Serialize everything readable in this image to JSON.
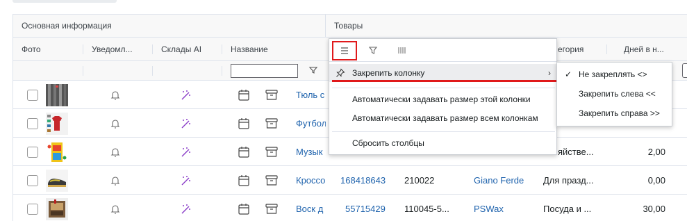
{
  "group_headers": {
    "main": "Основная информация",
    "products": "Товары"
  },
  "columns": {
    "photo": "Фото",
    "notifications": "Уведомл...",
    "warehouses_ai": "Склады AI",
    "name": "Название",
    "category": "егория",
    "days": "Дней в н..."
  },
  "rows": [
    {
      "name": "Тюль с",
      "id": "",
      "code": "",
      "brand": "",
      "category": "",
      "days": ""
    },
    {
      "name": "Футбол",
      "id": "",
      "code": "",
      "brand": "",
      "category": "",
      "days": ""
    },
    {
      "name": "Музык",
      "id": "",
      "code": "",
      "brand": "",
      "category": "яйстве...",
      "days": "2,00"
    },
    {
      "name": "Кроссо",
      "id": "168418643",
      "code": "210022",
      "brand": "Giano Ferde",
      "category": "Для празд...",
      "days": "0,00"
    },
    {
      "name": "Воск д",
      "id": "55715429",
      "code": "110045-5...",
      "brand": "PSWax",
      "category": "Посуда и ...",
      "days": "30,00"
    }
  ],
  "column_menu": {
    "pin_column": "Закрепить колонку",
    "autosize_this": "Автоматически задавать размер этой колонки",
    "autosize_all": "Автоматически задавать размер всем колонкам",
    "reset_columns": "Сбросить столбцы"
  },
  "pin_submenu": {
    "no_pin": "Не закреплять <>",
    "pin_left": "Закрепить слева <<",
    "pin_right": "Закрепить справа >>",
    "checked": "✓"
  },
  "colors": {
    "link": "#1f63ad",
    "highlight_red": "#e0191b",
    "ai_icon": "#8a3cc8"
  }
}
